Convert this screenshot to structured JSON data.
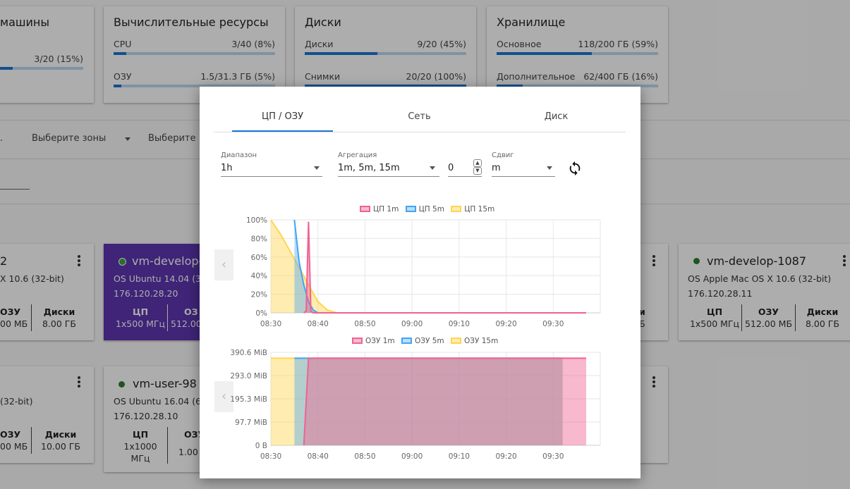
{
  "quotas": {
    "machines": {
      "title": "машины",
      "value": "3/20 (15%)",
      "pct": 0.15
    },
    "compute": {
      "title": "Вычислительные ресурсы",
      "rows": [
        {
          "label": "CPU",
          "value": "3/40 (8%)",
          "pct": 0.08
        },
        {
          "label": "ОЗУ",
          "value": "1.5/31.3 ГБ (5%)",
          "pct": 0.05
        }
      ]
    },
    "disks": {
      "title": "Диски",
      "rows": [
        {
          "label": "Диски",
          "value": "9/20 (45%)",
          "pct": 0.45
        },
        {
          "label": "Снимки",
          "value": "20/20 (100%)",
          "pct": 1.0
        }
      ]
    },
    "storage": {
      "title": "Хранилище",
      "rows": [
        {
          "label": "Основное",
          "value": "118/200 ГБ (59%)",
          "pct": 0.59
        },
        {
          "label": "Дополнительное",
          "value": "62/400 ГБ (16%)",
          "pct": 0.16
        }
      ]
    }
  },
  "filters": {
    "first": ".",
    "zones": "Выберите зоны",
    "third": "Выберите"
  },
  "vm_cards": {
    "c1": {
      "name": "2",
      "os": "X 10.6 (32-bit)",
      "spec_head": [
        "ОЗУ",
        "Диски"
      ],
      "spec_val": [
        "00 МБ",
        "8.00 ГБ"
      ]
    },
    "c2": {
      "name": "vm-develop-",
      "os": "OS Ubuntu 14.04 (3",
      "ip": "176.120.28.20",
      "spec_head": [
        "ЦП",
        "ОЗ"
      ],
      "spec_val": [
        "1x500 МГц",
        "512.00"
      ]
    },
    "c3": {
      "name": "vm-develop-1087",
      "os": "OS Apple Mac OS X 10.6 (32-bit)",
      "ip": "176.120.28.11",
      "spec_head": [
        "ЦП",
        "ОЗУ",
        "Диски"
      ],
      "spec_val": [
        "1x500 МГц",
        "512.00 МБ",
        "8.00 ГБ"
      ]
    },
    "c4": {
      "os": "(32-bit)",
      "spec_head": [
        "ОЗУ",
        "Диски"
      ],
      "spec_val": [
        "00 МБ",
        "10.00 ГБ"
      ]
    },
    "c5": {
      "name": "vm-user-98",
      "os": "OS Ubuntu 16.04 (6",
      "ip": "176.120.28.10",
      "spec_head": [
        "ЦП",
        "ОЗУ"
      ],
      "spec_val1": "1x1000",
      "spec_val2": "МГц",
      "spec_val3": "1.00"
    },
    "peek": {
      "h1": "и",
      "v1": "Б",
      "h2": "и",
      "v2": "Б"
    }
  },
  "modal": {
    "tabs": [
      "ЦП / ОЗУ",
      "Сеть",
      "Диск"
    ],
    "active_tab": 0,
    "range_label": "Диапазон",
    "range_value": "1h",
    "agg_label": "Агрегация",
    "agg_value": "1m, 5m, 15m",
    "number_value": "0",
    "shift_label": "Сдвиг",
    "shift_value": "m"
  },
  "chart_data": [
    {
      "type": "area",
      "x_ticks": [
        "08:30",
        "08:40",
        "08:50",
        "09:00",
        "09:10",
        "09:20",
        "09:30"
      ],
      "y_ticks": [
        "0%",
        "20%",
        "40%",
        "60%",
        "80%",
        "100%"
      ],
      "ylim": [
        0,
        100
      ],
      "legend_position": "top",
      "series": [
        {
          "name": "ЦП 1m",
          "color": "#f06292",
          "x": [
            "08:37",
            "08:37:30",
            "08:38",
            "08:38:30",
            "08:39",
            "09:37"
          ],
          "values": [
            0,
            2,
            98,
            2,
            0,
            0
          ]
        },
        {
          "name": "ЦП 5m",
          "color": "#42a5f5",
          "x": [
            "08:35",
            "08:36",
            "08:37",
            "08:38",
            "08:39",
            "08:40"
          ],
          "values": [
            100,
            55,
            30,
            12,
            3,
            0
          ]
        },
        {
          "name": "ЦП 15m",
          "color": "#ffd54f",
          "x": [
            "08:30",
            "08:32",
            "08:35",
            "08:38",
            "08:40",
            "08:42",
            "08:44"
          ],
          "values": [
            100,
            85,
            58,
            30,
            12,
            3,
            0
          ]
        }
      ]
    },
    {
      "type": "area",
      "x_ticks": [
        "08:30",
        "08:40",
        "08:50",
        "09:00",
        "09:10",
        "09:20",
        "09:30"
      ],
      "y_ticks": [
        "0 B",
        "97.7 MiB",
        "195.3 MiB",
        "293.0 MiB",
        "390.6 MiB"
      ],
      "ylim": [
        0,
        390.6
      ],
      "legend_position": "top",
      "series": [
        {
          "name": "ОЗУ 1m",
          "color": "#f06292",
          "x": [
            "08:37",
            "08:38",
            "09:37"
          ],
          "values": [
            0,
            366,
            366
          ]
        },
        {
          "name": "ОЗУ 5m",
          "color": "#42a5f5",
          "x": [
            "08:35",
            "08:37",
            "09:32"
          ],
          "values": [
            366,
            366,
            366
          ]
        },
        {
          "name": "ОЗУ 15m",
          "color": "#ffd54f",
          "x": [
            "08:30",
            "08:35",
            "09:32"
          ],
          "values": [
            366,
            366,
            366
          ]
        }
      ]
    }
  ]
}
